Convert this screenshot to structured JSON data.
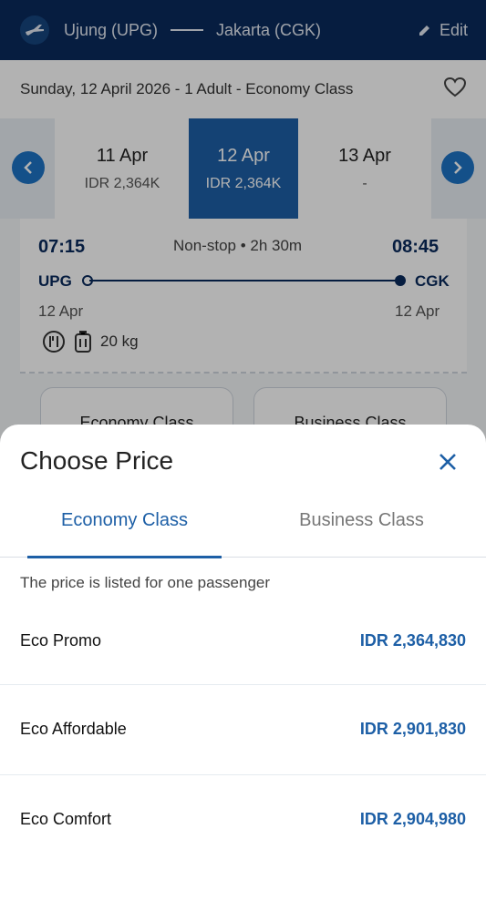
{
  "header": {
    "origin": "Ujung (UPG)",
    "destination": "Jakarta (CGK)",
    "edit_label": "Edit"
  },
  "subhead": {
    "summary": "Sunday, 12 April 2026 - 1 Adult - Economy Class"
  },
  "dates": [
    {
      "date": "11 Apr",
      "price": "IDR 2,364K"
    },
    {
      "date": "12 Apr",
      "price": "IDR 2,364K"
    },
    {
      "date": "13 Apr",
      "price": "-"
    }
  ],
  "flight": {
    "depart_time": "07:15",
    "arrive_time": "08:45",
    "info": "Non-stop • 2h 30m",
    "origin_code": "UPG",
    "dest_code": "CGK",
    "depart_date": "12 Apr",
    "arrive_date": "12 Apr",
    "baggage": "20 kg"
  },
  "class_buttons": [
    "Economy Class",
    "Business Class"
  ],
  "sheet": {
    "title": "Choose Price",
    "tabs": [
      {
        "label": "Economy Class"
      },
      {
        "label": "Business Class"
      }
    ],
    "note": "The price is listed for one passenger",
    "prices": [
      {
        "name": "Eco Promo",
        "amount": "IDR 2,364,830"
      },
      {
        "name": "Eco Affordable",
        "amount": "IDR 2,901,830"
      },
      {
        "name": "Eco Comfort",
        "amount": "IDR 2,904,980"
      }
    ]
  },
  "colors": {
    "navy": "#0a2a5c",
    "accent": "#1d5fa6"
  }
}
